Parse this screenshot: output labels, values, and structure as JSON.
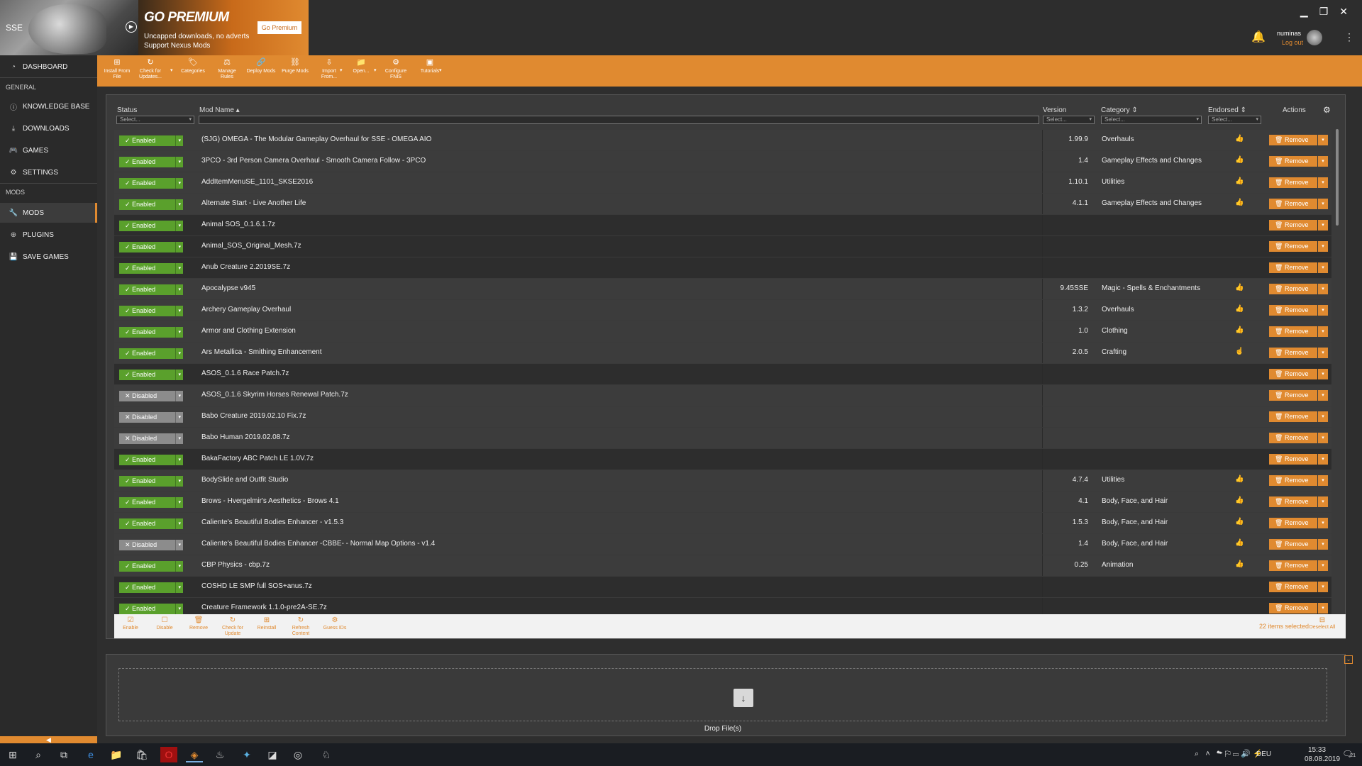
{
  "header": {
    "game_label": "SSE",
    "premium": {
      "title": "GO PREMIUM",
      "line1": "Uncapped downloads, no adverts",
      "line2": "Support Nexus Mods",
      "button": "Go Premium"
    },
    "user": {
      "name": "numinas",
      "logout": "Log out"
    }
  },
  "sidebar": {
    "dashboard": "DASHBOARD",
    "general_head": "GENERAL",
    "knowledge": "KNOWLEDGE BASE",
    "downloads": "DOWNLOADS",
    "games": "GAMES",
    "settings": "SETTINGS",
    "mods_head": "MODS",
    "mods": "MODS",
    "plugins": "PLUGINS",
    "savegames": "SAVE GAMES"
  },
  "toolbar": [
    {
      "l1": "Install From",
      "l2": "File"
    },
    {
      "l1": "Check for",
      "l2": "Updates..."
    },
    {
      "l1": "Categories",
      "l2": ""
    },
    {
      "l1": "Manage",
      "l2": "Rules"
    },
    {
      "l1": "Deploy Mods",
      "l2": ""
    },
    {
      "l1": "Purge Mods",
      "l2": ""
    },
    {
      "l1": "Import",
      "l2": "From..."
    },
    {
      "l1": "Open...",
      "l2": ""
    },
    {
      "l1": "Configure",
      "l2": "FNIS"
    },
    {
      "l1": "Tutorials",
      "l2": ""
    }
  ],
  "table": {
    "headers": {
      "status": "Status",
      "name": "Mod Name ▴",
      "version": "Version",
      "category": "Category ⇕",
      "endorsed": "Endorsed ⇕",
      "actions": "Actions"
    },
    "filter_placeholder": "Select...",
    "enabled_label": "Enabled",
    "disabled_label": "Disabled",
    "remove_label": "Remove",
    "rows": [
      {
        "status": "en",
        "name": "(SJG) OMEGA - The Modular Gameplay Overhaul for SSE - OMEGA AIO",
        "version": "1.99.9",
        "category": "Overhauls",
        "endorsed": "solid",
        "shade": "light"
      },
      {
        "status": "en",
        "name": "3PCO - 3rd Person Camera Overhaul - Smooth Camera Follow - 3PCO",
        "version": "1.4",
        "category": "Gameplay Effects and Changes",
        "endorsed": "solid",
        "shade": "light"
      },
      {
        "status": "en",
        "name": "AddItemMenuSE_1101_SKSE2016",
        "version": "1.10.1",
        "category": "Utilities",
        "endorsed": "solid",
        "shade": "light"
      },
      {
        "status": "en",
        "name": "Alternate Start - Live Another Life",
        "version": "4.1.1",
        "category": "Gameplay Effects and Changes",
        "endorsed": "solid",
        "shade": "light"
      },
      {
        "status": "en",
        "name": "Animal SOS_0.1.6.1.7z",
        "version": "",
        "category": "",
        "endorsed": "",
        "shade": "dark"
      },
      {
        "status": "en",
        "name": "Animal_SOS_Original_Mesh.7z",
        "version": "",
        "category": "",
        "endorsed": "",
        "shade": "dark"
      },
      {
        "status": "en",
        "name": "Anub Creature 2.2019SE.7z",
        "version": "",
        "category": "",
        "endorsed": "",
        "shade": "dark"
      },
      {
        "status": "en",
        "name": "Apocalypse v945",
        "version": "9.45SSE",
        "category": "Magic - Spells & Enchantments",
        "endorsed": "solid",
        "shade": "light"
      },
      {
        "status": "en",
        "name": "Archery Gameplay Overhaul",
        "version": "1.3.2",
        "category": "Overhauls",
        "endorsed": "solid",
        "shade": "light"
      },
      {
        "status": "en",
        "name": "Armor and Clothing Extension",
        "version": "1.0",
        "category": "Clothing",
        "endorsed": "solid",
        "shade": "light"
      },
      {
        "status": "en",
        "name": "Ars Metallica - Smithing Enhancement",
        "version": "2.0.5",
        "category": "Crafting",
        "endorsed": "outline",
        "shade": "light"
      },
      {
        "status": "en",
        "name": "ASOS_0.1.6 Race Patch.7z",
        "version": "",
        "category": "",
        "endorsed": "",
        "shade": "dark"
      },
      {
        "status": "dis",
        "name": "ASOS_0.1.6 Skyrim Horses Renewal Patch.7z",
        "version": "",
        "category": "",
        "endorsed": "",
        "shade": "light"
      },
      {
        "status": "dis",
        "name": "Babo Creature 2019.02.10 Fix.7z",
        "version": "",
        "category": "",
        "endorsed": "",
        "shade": "light"
      },
      {
        "status": "dis",
        "name": "Babo Human 2019.02.08.7z",
        "version": "",
        "category": "",
        "endorsed": "",
        "shade": "light"
      },
      {
        "status": "en",
        "name": "BakaFactory ABC Patch LE 1.0V.7z",
        "version": "",
        "category": "",
        "endorsed": "",
        "shade": "dark"
      },
      {
        "status": "en",
        "name": "BodySlide and Outfit Studio",
        "version": "4.7.4",
        "category": "Utilities",
        "endorsed": "solid",
        "shade": "light"
      },
      {
        "status": "en",
        "name": "Brows - Hvergelmir's Aesthetics - Brows 4.1",
        "version": "4.1",
        "category": "Body, Face, and Hair",
        "endorsed": "solid",
        "shade": "light"
      },
      {
        "status": "en",
        "name": "Caliente's Beautiful Bodies Enhancer - v1.5.3",
        "version": "1.5.3",
        "category": "Body, Face, and Hair",
        "endorsed": "solid",
        "shade": "light"
      },
      {
        "status": "dis",
        "name": "Caliente's Beautiful Bodies Enhancer -CBBE- - Normal Map Options - v1.4",
        "version": "1.4",
        "category": "Body, Face, and Hair",
        "endorsed": "solid",
        "shade": "light"
      },
      {
        "status": "en",
        "name": "CBP Physics - cbp.7z",
        "version": "0.25",
        "category": "Animation",
        "endorsed": "solid",
        "shade": "light"
      },
      {
        "status": "en",
        "name": "COSHD LE SMP full SOS+anus.7z",
        "version": "",
        "category": "",
        "endorsed": "",
        "shade": "dark"
      },
      {
        "status": "en",
        "name": "Creature Framework 1.1.0-pre2A-SE.7z",
        "version": "",
        "category": "",
        "endorsed": "",
        "shade": "dark"
      }
    ]
  },
  "selection_bar": {
    "buttons": [
      {
        "l1": "Enable",
        "l2": ""
      },
      {
        "l1": "Disable",
        "l2": ""
      },
      {
        "l1": "Remove",
        "l2": ""
      },
      {
        "l1": "Check for",
        "l2": "Update"
      },
      {
        "l1": "Reinstall",
        "l2": ""
      },
      {
        "l1": "Refresh",
        "l2": "Content"
      },
      {
        "l1": "Guess IDs",
        "l2": ""
      }
    ],
    "count": "22 items selected",
    "deselect": "Deselect All"
  },
  "drop": {
    "label": "Drop File(s)"
  },
  "taskbar": {
    "lang": "DEU",
    "time": "15:33",
    "date": "08.08.2019",
    "notif_count": "21"
  }
}
